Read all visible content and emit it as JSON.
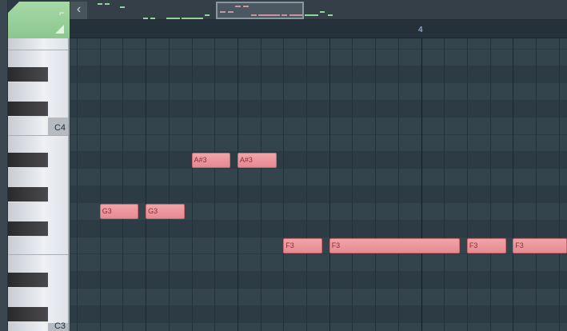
{
  "navigator": {
    "back_icon": "chevron-left-icon"
  },
  "ruler": {
    "bar_label": "4"
  },
  "keyboard": {
    "labels": [
      {
        "pitch": 60,
        "text": "C4"
      },
      {
        "pitch": 48,
        "text": "C3"
      }
    ]
  },
  "notes": [
    {
      "label": "G3",
      "pitch": 55,
      "start": 1.0,
      "length": 1.7
    },
    {
      "label": "G3",
      "pitch": 55,
      "start": 3.0,
      "length": 1.7
    },
    {
      "label": "A#3",
      "pitch": 58,
      "start": 5.0,
      "length": 1.7
    },
    {
      "label": "A#3",
      "pitch": 58,
      "start": 7.0,
      "length": 1.7
    },
    {
      "label": "F3",
      "pitch": 53,
      "start": 9.0,
      "length": 1.7
    },
    {
      "label": "F3",
      "pitch": 53,
      "start": 11.0,
      "length": 5.7
    },
    {
      "label": "F3",
      "pitch": 53,
      "start": 17.0,
      "length": 1.7
    },
    {
      "label": "F3",
      "pitch": 53,
      "start": 19.0,
      "length": 3.0
    }
  ],
  "colors": {
    "note": "#e8939a",
    "tool_tab": "#9dd29f"
  }
}
